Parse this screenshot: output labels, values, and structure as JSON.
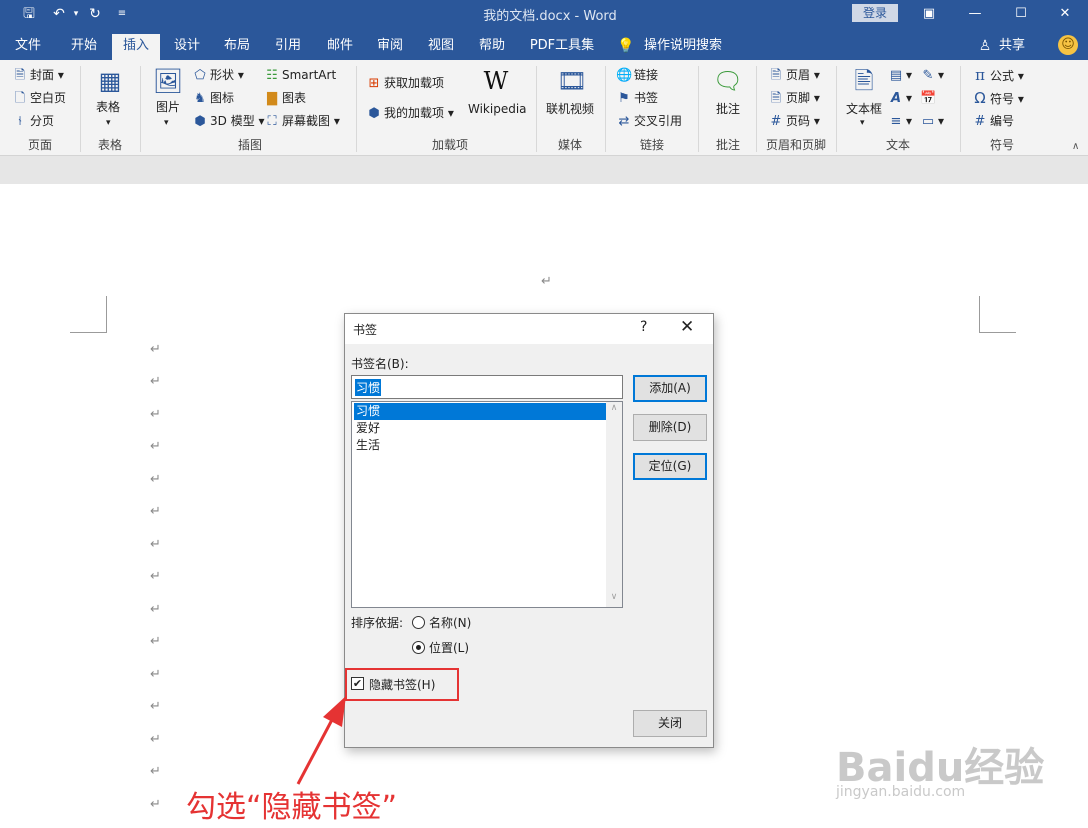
{
  "titlebar": {
    "title": "我的文档.docx  -  Word",
    "login": "登录",
    "qat": [
      "save",
      "undo",
      "redo",
      "customize"
    ]
  },
  "tabs": [
    "文件",
    "开始",
    "插入",
    "设计",
    "布局",
    "引用",
    "邮件",
    "审阅",
    "视图",
    "帮助",
    "PDF工具集",
    "操作说明搜索"
  ],
  "active_tab": "插入",
  "share": "共享",
  "ribbon": {
    "pages": {
      "cover": "封面",
      "blank": "空白页",
      "break": "分页",
      "label": "页面"
    },
    "tables": {
      "table": "表格",
      "label": "表格"
    },
    "illustrations": {
      "picture": "图片",
      "shapes": "形状",
      "icons": "图标",
      "model3d": "3D 模型",
      "smartart": "SmartArt",
      "chart": "图表",
      "screenshot": "屏幕截图",
      "label": "插图"
    },
    "addins": {
      "get": "获取加载项",
      "mine": "我的加载项",
      "wikipedia": "Wikipedia",
      "label": "加载项"
    },
    "media": {
      "video": "联机视频",
      "label": "媒体"
    },
    "links": {
      "link": "链接",
      "bookmark": "书签",
      "crossref": "交叉引用",
      "label": "链接"
    },
    "comments": {
      "comment": "批注",
      "label": "批注"
    },
    "headerfooter": {
      "header": "页眉",
      "footer": "页脚",
      "pagenum": "页码",
      "label": "页眉和页脚"
    },
    "text": {
      "textbox": "文本框",
      "label": "文本"
    },
    "symbols": {
      "equation": "公式",
      "symbol": "符号",
      "number": "编号",
      "label": "符号"
    }
  },
  "dialog": {
    "title": "书签",
    "help": "?",
    "name_label": "书签名(B):",
    "name_value": "习惯",
    "items": [
      "习惯",
      "爱好",
      "生活"
    ],
    "selected_index": 0,
    "buttons": {
      "add": "添加(A)",
      "delete": "删除(D)",
      "goto": "定位(G)",
      "close": "关闭"
    },
    "sort_label": "排序依据:",
    "sort_options": [
      "名称(N)",
      "位置(L)"
    ],
    "sort_selected": "位置(L)",
    "hidden_label": "隐藏书签(H)",
    "hidden_checked": true
  },
  "annotation": {
    "caption": "勾选“隐藏书签”",
    "color": "#e53333"
  },
  "watermark": {
    "brand": "Baidu经验",
    "url": "jingyan.baidu.com"
  },
  "colors": {
    "ribbon_blue": "#2b579a",
    "selection_blue": "#0078d7"
  }
}
